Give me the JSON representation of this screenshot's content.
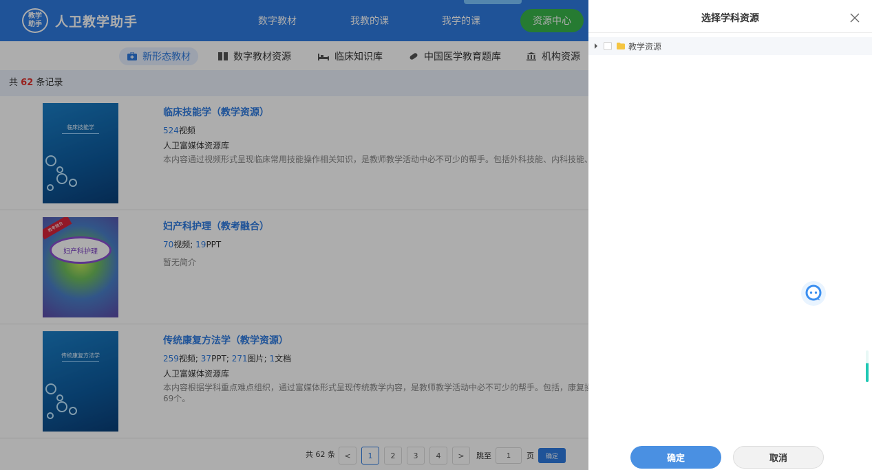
{
  "app": {
    "logo_top": "教学",
    "logo_bottom": "助手",
    "name": "人卫教学助手"
  },
  "nav": {
    "items": [
      "数字教材",
      "我教的课",
      "我学的课"
    ],
    "resource_center": "资源中心"
  },
  "subnav": {
    "items": [
      {
        "label": "新形态教材",
        "icon": "briefcase-plus-icon"
      },
      {
        "label": "数字教材资源",
        "icon": "book-icon"
      },
      {
        "label": "临床知识库",
        "icon": "bed-icon"
      },
      {
        "label": "中国医学教育题库",
        "icon": "pill-icon"
      },
      {
        "label": "机构资源",
        "icon": "institution-icon"
      }
    ]
  },
  "count": {
    "prefix": "共",
    "number": "62",
    "suffix": "条记录"
  },
  "list": [
    {
      "title": "临床技能学（教学资源）",
      "cover_title": "临床技能学",
      "stats": [
        {
          "n": "524",
          "unit": "视频"
        }
      ],
      "publisher": "人卫富媒体资源库",
      "desc": "本内容通过视频形式呈现临床常用技能操作相关知识，是教师教学活动中必不可少的帮手。包括外科技能、内科技能、急诊"
    },
    {
      "title": "妇产科护理（教考融合）",
      "cover_title": "妇产科护理",
      "cover_badge": "教考融合",
      "stats": [
        {
          "n": "70",
          "unit": "视频"
        },
        {
          "n": "19",
          "unit": "PPT"
        }
      ],
      "publisher": "",
      "desc": "暂无简介"
    },
    {
      "title": "传统康复方法学（教学资源）",
      "cover_title": "传统康复方法学",
      "stats": [
        {
          "n": "259",
          "unit": "视频"
        },
        {
          "n": "37",
          "unit": "PPT"
        },
        {
          "n": "271",
          "unit": "图片"
        },
        {
          "n": "1",
          "unit": "文档"
        }
      ],
      "publisher": "人卫富媒体资源库",
      "desc": "本内容根据学科重点难点组织，通过富媒体形式呈现传统教学内容，是教师教学活动中必不可少的帮手。包括，康复操作技",
      "desc_line2": "69个。"
    }
  ],
  "pager": {
    "total": "共 62 条",
    "prev": "<",
    "pages": [
      "1",
      "2",
      "3",
      "4"
    ],
    "current": "1",
    "next": ">",
    "goto_label": "跳至",
    "goto_value": "1",
    "page_unit": "页",
    "confirm": "确定"
  },
  "drawer": {
    "title": "选择学科资源",
    "tree": [
      {
        "label": "教学资源",
        "icon": "folder-icon"
      }
    ],
    "confirm": "确定",
    "cancel": "取消"
  },
  "colors": {
    "primary": "#2e7be0",
    "green": "#39b54a",
    "count_red": "#e0332f",
    "folder": "#f5c542"
  }
}
